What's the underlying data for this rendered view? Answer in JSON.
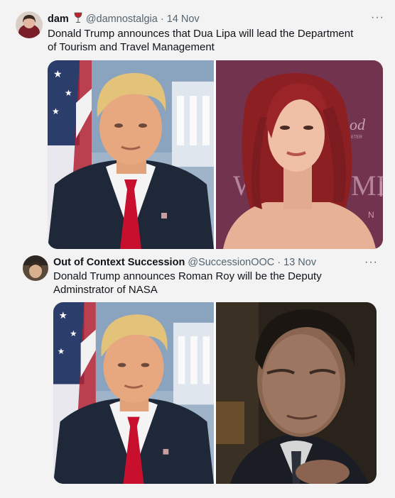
{
  "tweets": [
    {
      "name": "dam",
      "handle": "@damnostalgia",
      "date": "· 14 Nov",
      "text": "Donald Trump announces that Dua Lipa will lead the Department of Tourism and Travel Management",
      "images": [
        "trump-portrait",
        "dua-lipa-photo"
      ],
      "overlay_text": [
        "od",
        "ETER",
        "W",
        "MI",
        "I",
        "N"
      ]
    },
    {
      "name": "Out of Context Succession",
      "handle": "@SuccessionOOC",
      "date": "· 13 Nov",
      "text": "Donald Trump announces Roman Roy will be the Deputy Adminstrator of NASA",
      "images": [
        "trump-portrait",
        "roman-roy-still"
      ]
    }
  ],
  "more_glyph": "···",
  "colors": {
    "background": "#f3f3f3",
    "text": "#0f1419",
    "muted": "#536471"
  }
}
